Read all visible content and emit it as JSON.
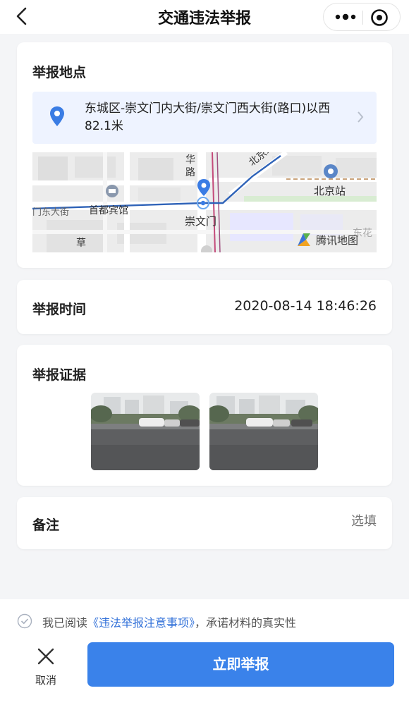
{
  "nav": {
    "title": "交通违法举报"
  },
  "location": {
    "title": "举报地点",
    "address": "东城区-崇文门内大街/崇文门西大街(路口)以西82.1米",
    "map": {
      "labels": {
        "hua": "华",
        "lu": "路",
        "beijingzhan_road": "北京站路",
        "beijing_station": "北京站",
        "east_street": "门东大街",
        "hotel": "首都宾馆",
        "chongwenmen": "崇文门",
        "cao": "草",
        "dongcheng_partial": "东花"
      },
      "provider": "腾讯地图"
    }
  },
  "time": {
    "title": "举报时间",
    "value": "2020-08-14 18:46:26"
  },
  "evidence": {
    "title": "举报证据"
  },
  "remark": {
    "title": "备注",
    "placeholder": "选填"
  },
  "agreement": {
    "prefix": "我已阅读",
    "link": "《违法举报注意事项》",
    "suffix": "，承诺材料的真实性"
  },
  "actions": {
    "cancel": "取消",
    "submit": "立即举报"
  },
  "colors": {
    "accent": "#3a82ea",
    "link": "#2f6fd8",
    "address_bg": "#eef3ff"
  }
}
